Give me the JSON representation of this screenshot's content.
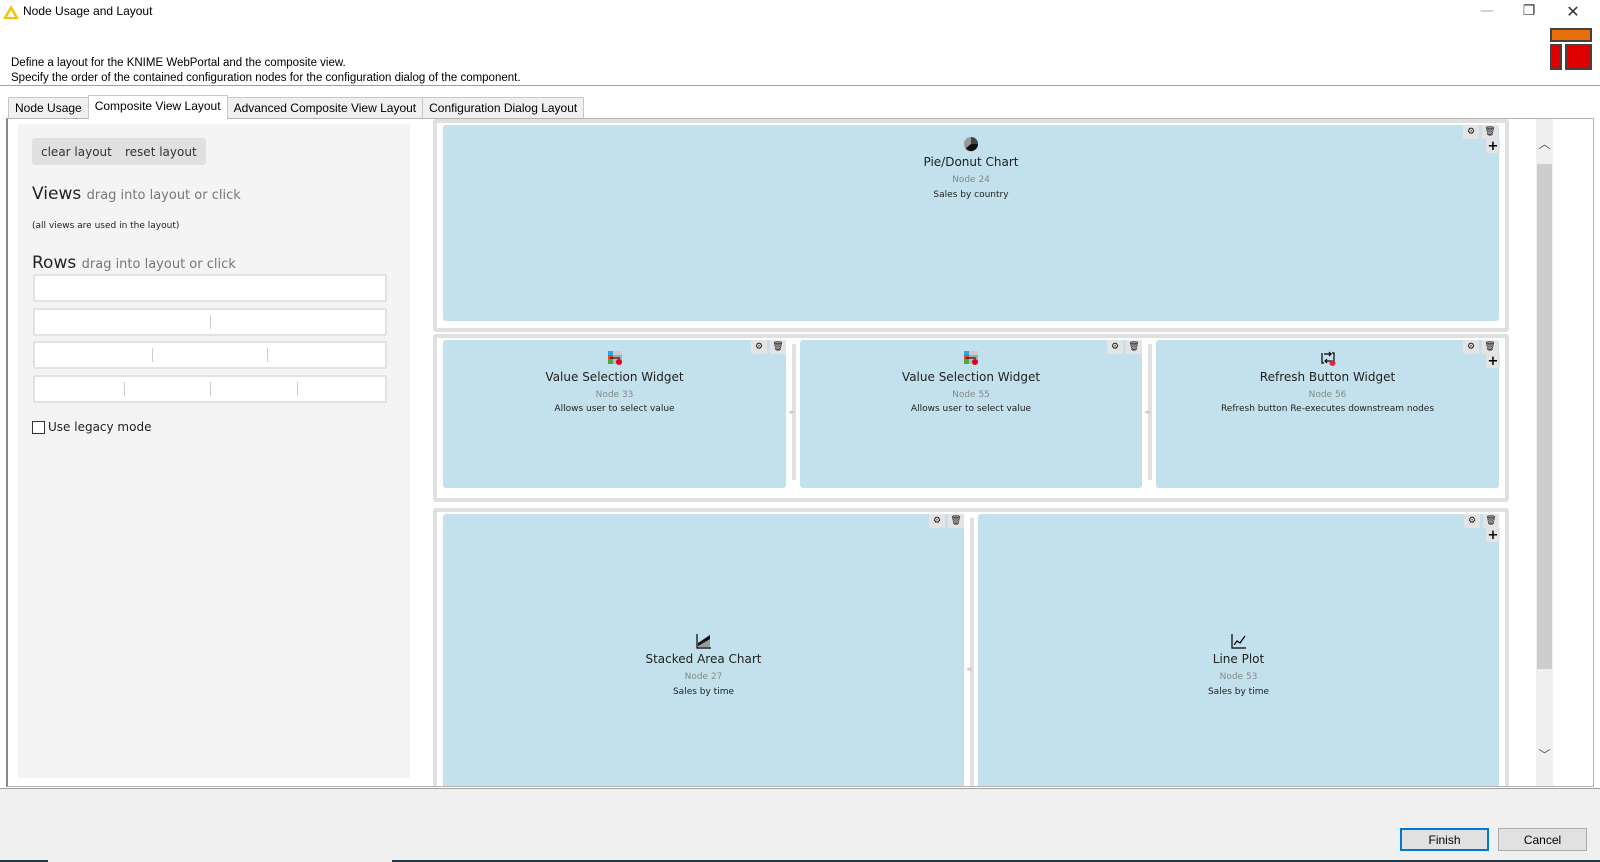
{
  "window": {
    "title": "Node Usage and Layout",
    "controls": {
      "minimize": "—",
      "restore": "❐",
      "close": "✕"
    }
  },
  "header": {
    "line1": "Define a layout for the KNIME WebPortal and the composite view.",
    "line2": "Specify the order of the contained configuration nodes for the configuration dialog of the component."
  },
  "tabs": [
    {
      "label": "Node Usage",
      "active": false
    },
    {
      "label": "Composite View Layout",
      "active": true
    },
    {
      "label": "Advanced Composite View Layout",
      "active": false
    },
    {
      "label": "Configuration Dialog Layout",
      "active": false
    }
  ],
  "left_panel": {
    "clear_label": "clear layout",
    "reset_label": "reset layout",
    "views_title": "Views",
    "views_sub": "drag into layout or click",
    "views_note": "(all views are used in the layout)",
    "rows_title": "Rows",
    "rows_sub": "drag into layout or click",
    "row_templates": [
      {
        "columns": 1
      },
      {
        "columns": 2
      },
      {
        "columns": 3
      },
      {
        "columns": 4
      }
    ],
    "legacy_label": "Use legacy mode",
    "legacy_checked": false
  },
  "layout": {
    "rows": [
      {
        "columns": [
          {
            "icon": "pie-chart-icon",
            "name": "Pie/Donut Chart",
            "node": "Node 24",
            "desc": "Sales by country"
          }
        ]
      },
      {
        "columns": [
          {
            "icon": "value-selection-icon",
            "name": "Value Selection Widget",
            "node": "Node 33",
            "desc": "Allows user to select value"
          },
          {
            "icon": "value-selection-icon",
            "name": "Value Selection Widget",
            "node": "Node 55",
            "desc": "Allows user to select value"
          },
          {
            "icon": "refresh-button-icon",
            "name": "Refresh Button Widget",
            "node": "Node 56",
            "desc": "Refresh button Re-executes downstream nodes"
          }
        ]
      },
      {
        "columns": [
          {
            "icon": "stacked-area-icon",
            "name": "Stacked Area Chart",
            "node": "Node 27",
            "desc": "Sales by time"
          },
          {
            "icon": "line-plot-icon",
            "name": "Line Plot",
            "node": "Node 53",
            "desc": "Sales by time"
          }
        ]
      }
    ],
    "tool_icons": {
      "settings": "⚙",
      "delete": "🗑",
      "add": "+"
    }
  },
  "footer": {
    "finish_label": "Finish",
    "cancel_label": "Cancel"
  },
  "colors": {
    "column_bg": "#c2e1ec",
    "row_border": "#e0e0e0",
    "focus_blue": "#0078d7",
    "banner_orange": "#e8700a",
    "banner_red": "#e00000"
  }
}
